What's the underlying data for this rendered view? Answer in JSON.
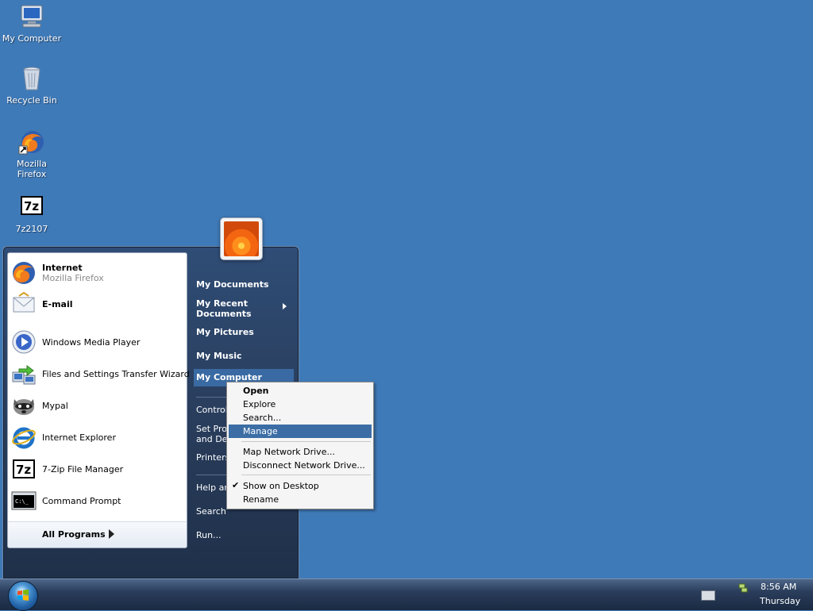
{
  "desktop": {
    "icons": [
      {
        "label": "My Computer",
        "icon": "computer-icon"
      },
      {
        "label": "Recycle Bin",
        "icon": "recycle-bin-icon"
      },
      {
        "label": "Mozilla Firefox",
        "icon": "firefox-icon"
      },
      {
        "label": "7z2107",
        "icon": "7zip-icon"
      }
    ]
  },
  "start_menu": {
    "pinned": [
      {
        "title": "Internet",
        "subtitle": "Mozilla Firefox",
        "icon": "firefox-icon"
      },
      {
        "title": "E-mail",
        "subtitle": "",
        "icon": "email-icon"
      }
    ],
    "recent": [
      {
        "label": "Windows Media Player",
        "icon": "media-player-icon"
      },
      {
        "label": "Files and Settings Transfer Wizard",
        "icon": "transfer-wizard-icon"
      },
      {
        "label": "Mypal",
        "icon": "mypal-icon"
      },
      {
        "label": "Internet Explorer",
        "icon": "internet-explorer-icon"
      },
      {
        "label": "7-Zip File Manager",
        "icon": "7zip-icon"
      },
      {
        "label": "Command Prompt",
        "icon": "command-prompt-icon"
      }
    ],
    "all_programs": "All Programs",
    "right": {
      "my_documents": "My Documents",
      "my_recent_documents_1": "My Recent",
      "my_recent_documents_2": "Documents",
      "my_pictures": "My Pictures",
      "my_music": "My Music",
      "my_computer": "My Computer",
      "control_panel": "Control",
      "set_program_access_1": "Set Prog",
      "set_program_access_2": "and Def",
      "printers": "Printers",
      "help": "Help ar",
      "search": "Search",
      "run": "Run..."
    }
  },
  "context_menu": {
    "items": [
      {
        "label": "Open"
      },
      {
        "label": "Explore"
      },
      {
        "label": "Search..."
      },
      {
        "label": "Manage"
      },
      {
        "label": "Map Network Drive..."
      },
      {
        "label": "Disconnect Network Drive..."
      },
      {
        "label": "Show on Desktop",
        "checked": true
      },
      {
        "label": "Rename"
      }
    ],
    "highlighted": "Manage"
  },
  "taskbar": {
    "time": "8:56 AM",
    "day": "Thursday"
  },
  "colors": {
    "desktop_bg": "#3f7ab8",
    "highlight": "#3c6ea5"
  }
}
